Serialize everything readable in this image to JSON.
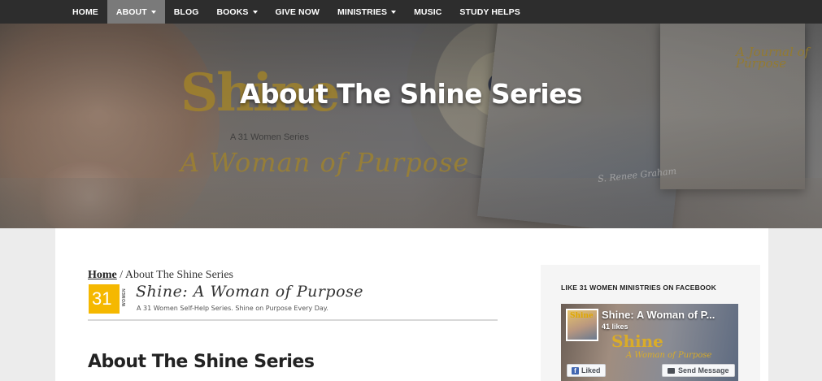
{
  "nav": {
    "items": [
      {
        "label": "HOME",
        "dropdown": false,
        "active": false
      },
      {
        "label": "ABOUT",
        "dropdown": true,
        "active": true
      },
      {
        "label": "BLOG",
        "dropdown": false,
        "active": false
      },
      {
        "label": "BOOKS",
        "dropdown": true,
        "active": false
      },
      {
        "label": "GIVE NOW",
        "dropdown": false,
        "active": false
      },
      {
        "label": "MINISTRIES",
        "dropdown": true,
        "active": false
      },
      {
        "label": "MUSIC",
        "dropdown": false,
        "active": false
      },
      {
        "label": "STUDY HELPS",
        "dropdown": false,
        "active": false
      }
    ]
  },
  "hero": {
    "title": "About The Shine Series",
    "art_shine": "Shine",
    "art_series": "A 31 Women Series",
    "art_wop": "A Woman of Purpose",
    "art_author": "S. Renee Graham",
    "art_journal": "A Journal of Purpose"
  },
  "breadcrumb": {
    "home": "Home",
    "separator": " / ",
    "current": "About The Shine Series"
  },
  "banner": {
    "logo_number": "31",
    "logo_word": "WOMEN",
    "title": "Shine: A Woman of Purpose",
    "subtitle": "A 31 Women Self-Help Series. Shine on Purpose Every Day."
  },
  "page": {
    "heading": "About The Shine Series"
  },
  "sidebar": {
    "fb_heading": "LIKE 31 WOMEN MINISTRIES ON FACEBOOK",
    "fb_page_name": "Shine: A Woman of P...",
    "fb_likes": "41 likes",
    "fb_thumb_text": "Shine",
    "fb_cover_shine": "Shine",
    "fb_cover_wop": "A Woman of Purpose",
    "fb_liked_label": "Liked",
    "fb_send_label": "Send Message"
  },
  "colors": {
    "nav_bg": "#2d2d2d",
    "nav_active": "#7a7a7a",
    "accent_gold": "#f5b800",
    "facebook_blue": "#4267b2"
  }
}
